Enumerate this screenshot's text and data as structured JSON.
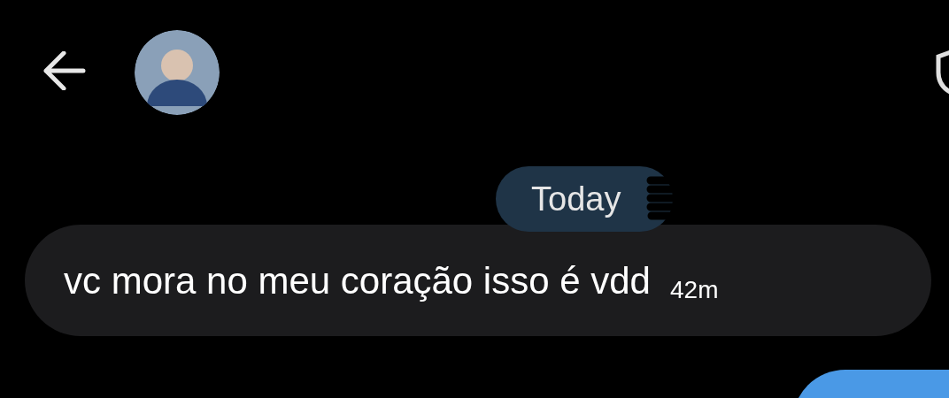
{
  "date_divider": "Today",
  "messages": [
    {
      "kind": "received",
      "text": "vc mora no meu coração isso é vdd",
      "time": "42m"
    },
    {
      "kind": "sent"
    }
  ]
}
